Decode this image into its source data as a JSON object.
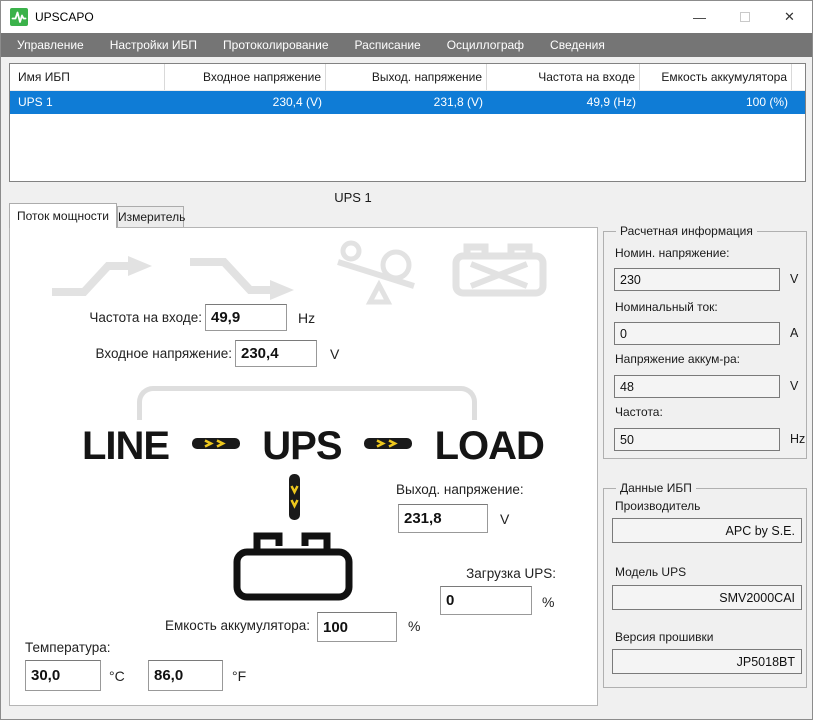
{
  "window": {
    "title": "UPSCAPO",
    "controls": {
      "minimize": "—",
      "close": "✕"
    }
  },
  "menu": {
    "items": [
      "Управление",
      "Настройки ИБП",
      "Протоколирование",
      "Расписание",
      "Осциллограф",
      "Сведения"
    ]
  },
  "ups_table": {
    "columns": [
      "Имя ИБП",
      "Входное напряжение",
      "Выход. напряжение",
      "Частота на входе",
      "Емкость аккумулятора"
    ],
    "rows": [
      {
        "name": "UPS 1",
        "input_voltage": "230,4 (V)",
        "output_voltage": "231,8 (V)",
        "input_frequency": "49,9 (Hz)",
        "battery_capacity": "100 (%)"
      }
    ]
  },
  "selected_ups_label": "UPS 1",
  "tabs": [
    {
      "label": "Поток мощности",
      "active": true
    },
    {
      "label": "Измеритель",
      "active": false
    }
  ],
  "power_flow": {
    "status_icons": [
      "boost-icon",
      "trim-icon",
      "overload-icon",
      "battery-fault-icon"
    ],
    "input_frequency": {
      "label": "Частота на входе:",
      "value": "49,9",
      "unit": "Hz"
    },
    "input_voltage": {
      "label": "Входное напряжение:",
      "value": "230,4",
      "unit": "V"
    },
    "output_voltage": {
      "label": "Выход. напряжение:",
      "value": "231,8",
      "unit": "V"
    },
    "ups_load": {
      "label": "Загрузка UPS:",
      "value": "0",
      "unit": "%"
    },
    "battery_capacity": {
      "label": "Емкость аккумулятора:",
      "value": "100",
      "unit": "%"
    },
    "temperature": {
      "label": "Температура:",
      "celsius": "30,0",
      "celsius_unit": "°C",
      "fahrenheit": "86,0",
      "fahrenheit_unit": "°F"
    },
    "diagram": {
      "source": "LINE",
      "ups": "UPS",
      "load": "LOAD"
    }
  },
  "calculated_info": {
    "title": "Расчетная информация",
    "fields": [
      {
        "label": "Номин. напряжение:",
        "value": "230",
        "unit": "V"
      },
      {
        "label": "Номинальный ток:",
        "value": "0",
        "unit": "A"
      },
      {
        "label": "Напряжение аккум-ра:",
        "value": "48",
        "unit": "V"
      },
      {
        "label": "Частота:",
        "value": "50",
        "unit": "Hz"
      }
    ]
  },
  "ups_data": {
    "title": "Данные ИБП",
    "fields": [
      {
        "label": "Производитель",
        "value": "APC by S.E."
      },
      {
        "label": "Модель UPS",
        "value": "SMV2000CAI"
      },
      {
        "label": "Версия прошивки",
        "value": "JP5018BT"
      }
    ]
  },
  "colors": {
    "selected_row_blue": "#0f7cd6",
    "menu_bar_gray": "#757575",
    "brand_green": "#3bb24a",
    "arrow_yellow": "#edc71d",
    "inactive_icon_gray": "#e2e2e2"
  }
}
